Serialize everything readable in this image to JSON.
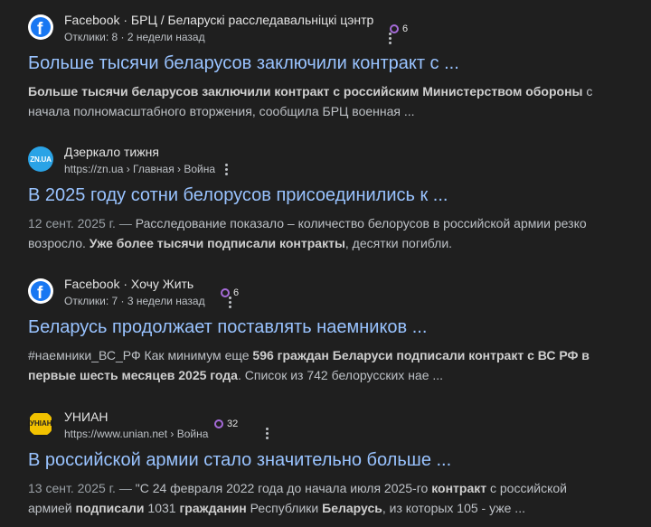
{
  "results": [
    {
      "favicon": "facebook-icon",
      "site": "Facebook · БРЦ / Беларускі расследавальніцкі цэнтр",
      "meta": "Отклики: 8 · 2 недели назад",
      "badge_count": "6",
      "title": "Больше тысячи беларусов заключили контракт с ...",
      "snippet": [
        {
          "t": "Больше тысячи беларусов заключили контракт с российским Министерством обороны",
          "b": true
        },
        {
          "t": " с начала полномасштабного вторжения, сообщила БРЦ военная ...",
          "b": false
        }
      ]
    },
    {
      "favicon": "zn-ua-icon",
      "favicon_text": "ZN.UA",
      "site": "Дзеркало тижня",
      "meta": "https://zn.ua › Главная › Война",
      "title": "В 2025 году сотни белорусов присоединились к ...",
      "snippet": [
        {
          "t": "12 сент. 2025 г. — ",
          "d": true
        },
        {
          "t": "Расследование показало – количество белорусов в российской армии резко возросло. ",
          "b": false
        },
        {
          "t": "Уже более тысячи подписали контракты",
          "b": true
        },
        {
          "t": ", десятки погибли.",
          "b": false
        }
      ]
    },
    {
      "favicon": "facebook-icon",
      "site": "Facebook · Хочу Жить",
      "meta": "Отклики: 7 · 3 недели назад",
      "badge_count": "6",
      "title": "Беларусь продолжает поставлять наемников ...",
      "snippet": [
        {
          "t": "#наемники_ВС_РФ Как минимум еще ",
          "b": false
        },
        {
          "t": "596 граждан Беларуси подписали контракт с ВС РФ в первые шесть месяцев 2025 года",
          "b": true
        },
        {
          "t": ". Список из 742 белорусских нае ...",
          "b": false
        }
      ]
    },
    {
      "favicon": "unian-icon",
      "favicon_text": "УНІАН",
      "site": "УНИАН",
      "meta": "https://www.unian.net › Война",
      "badge_count": "32",
      "title": "В российской армии стало значительно больше ...",
      "snippet": [
        {
          "t": "13 сент. 2025 г. — ",
          "d": true
        },
        {
          "t": "\"С 24 февраля 2022 года до начала июля 2025-го ",
          "b": false
        },
        {
          "t": "контракт",
          "b": true
        },
        {
          "t": " с российской армией ",
          "b": false
        },
        {
          "t": "подписали",
          "b": true
        },
        {
          "t": " 1031 ",
          "b": false
        },
        {
          "t": "гражданин",
          "b": true
        },
        {
          "t": " Республики ",
          "b": false
        },
        {
          "t": "Беларусь",
          "b": true
        },
        {
          "t": ", из которых 105 - уже ...",
          "b": false
        }
      ]
    }
  ],
  "colors": {
    "background": "#1f1f1f",
    "link": "#99c3ff",
    "badge_ring": "#a56bd8"
  }
}
